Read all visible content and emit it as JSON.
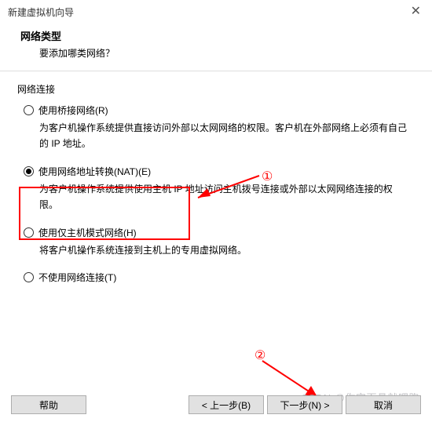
{
  "window": {
    "title": "新建虚拟机向导"
  },
  "header": {
    "title": "网络类型",
    "subtitle": "要添加哪类网络？"
  },
  "group": {
    "label": "网络连接"
  },
  "options": {
    "bridged": {
      "label": "使用桥接网络(R)",
      "desc": "为客户机操作系统提供直接访问外部以太网网络的权限。客户机在外部网络上必须有自己的 IP 地址。"
    },
    "nat": {
      "label": "使用网络地址转换(NAT)(E)",
      "desc": "为客户机操作系统提供使用主机 IP 地址访问主机拨号连接或外部以太网网络连接的权限。"
    },
    "hostonly": {
      "label": "使用仅主机模式网络(H)",
      "desc": "将客户机操作系统连接到主机上的专用虚拟网络。"
    },
    "none": {
      "label": "不使用网络连接(T)"
    }
  },
  "annotations": {
    "one": "①",
    "two": "②"
  },
  "buttons": {
    "help": "帮助",
    "back": "< 上一步(B)",
    "next": "下一步(N) >",
    "cancel": "取消"
  },
  "watermark": "CSDN @你完面具就嘿跑"
}
